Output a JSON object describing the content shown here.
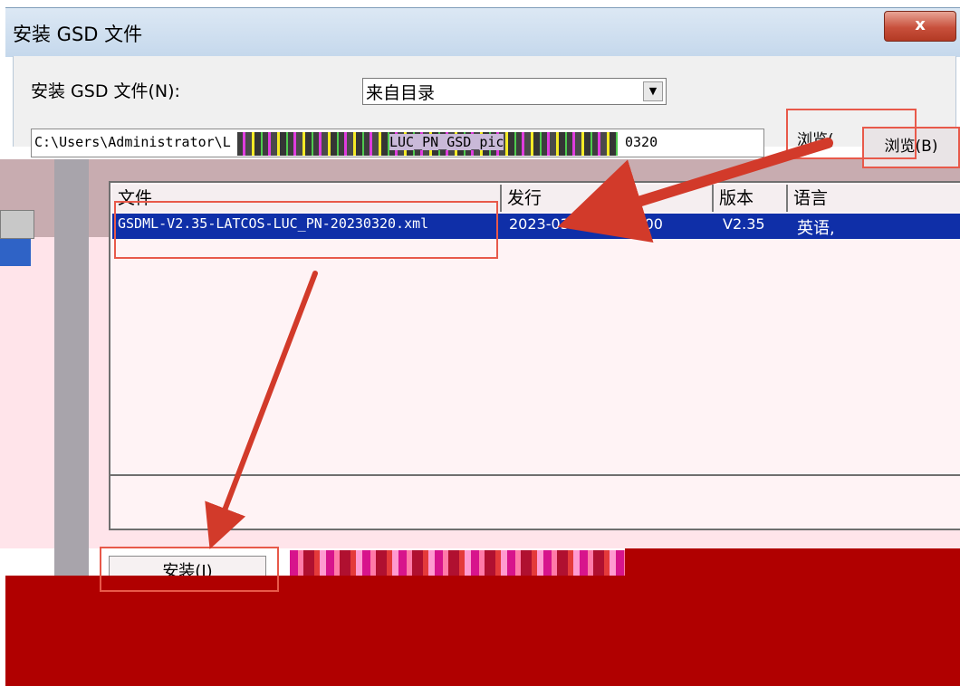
{
  "window": {
    "title": "安装 GSD 文件",
    "close_label": "x"
  },
  "form": {
    "install_label": "安装 GSD 文件(N):",
    "source_value": "来自目录",
    "path_value": "C:\\Users\\Administrator\\L",
    "path_tail": "LUC_PN_GSD_pic",
    "path_suffix": "0320",
    "browse_label": "浏览(B)",
    "browse_obscured": "浏览(",
    "dropdown_arrow": "▼"
  },
  "table": {
    "columns": [
      "文件",
      "发行",
      "版本",
      "语言"
    ],
    "rows": [
      {
        "file": "GSDML-V2.35-LATCOS-LUC_PN-20230320.xml",
        "release": "2023-03-20 00:00:00",
        "version": "V2.35",
        "language": "英语,"
      }
    ]
  },
  "buttons": {
    "install": "安装(I)"
  },
  "colors": {
    "selection": "#0f2fa8",
    "annotation": "#e8594a",
    "arrow": "#d23a2a",
    "redaction": "#b00000"
  }
}
